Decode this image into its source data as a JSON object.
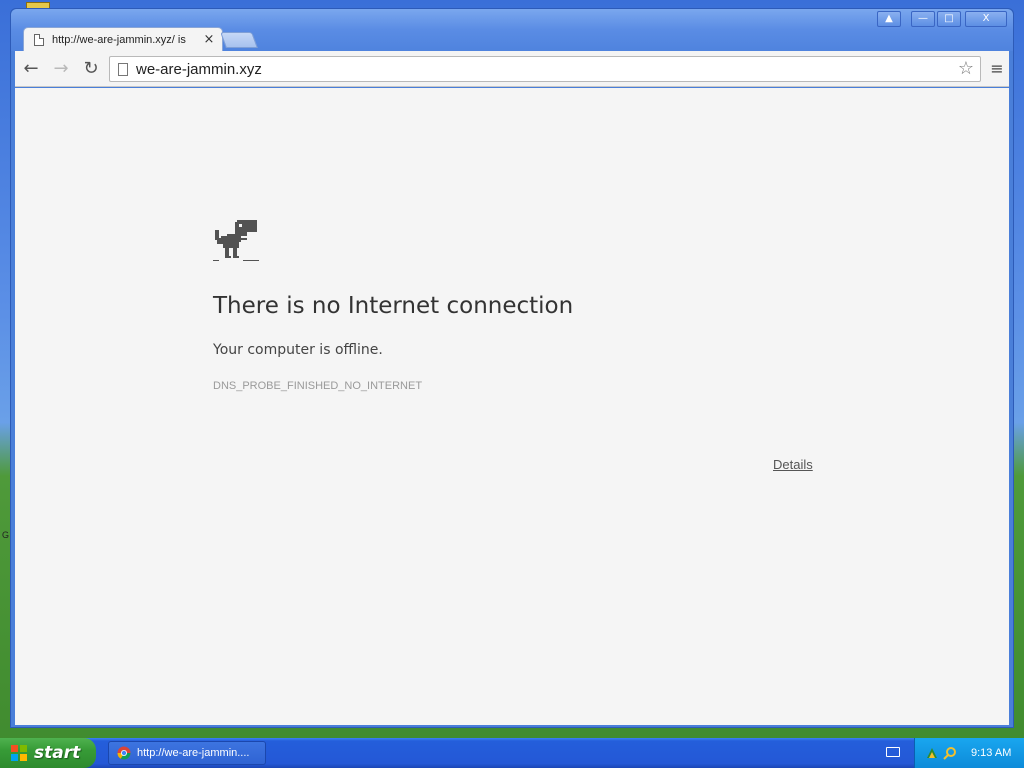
{
  "desktop": {
    "edge_letter": "G"
  },
  "browser": {
    "tab": {
      "title": "http://we-are-jammin.xyz/ is",
      "close_glyph": "×"
    },
    "window_controls": {
      "user": "▲",
      "minimize": "—",
      "maximize": "□",
      "close": "X"
    },
    "toolbar": {
      "back_glyph": "←",
      "forward_glyph": "→",
      "reload_glyph": "↻",
      "url": "we-are-jammin.xyz",
      "star_glyph": "☆",
      "menu_glyph": "≡"
    }
  },
  "error_page": {
    "heading": "There is no Internet connection",
    "subtext": "Your computer is offline.",
    "error_code": "DNS_PROBE_FINISHED_NO_INTERNET",
    "details_link": "Details"
  },
  "taskbar": {
    "start_label": "start",
    "task_item_label": "http://we-are-jammin....",
    "clock": "9:13 AM"
  },
  "colors": {
    "page_background": "#f5f5f5",
    "heading_text": "#333333",
    "error_code_text": "#9a9a9a",
    "taskbar_blue": "#245edb",
    "start_green": "#379b37",
    "tray_blue": "#0d8bd9"
  },
  "icons": [
    "page-icon",
    "star-icon",
    "menu-icon",
    "dino-icon",
    "windows-flag-icon",
    "chrome-icon",
    "keyboard-icon",
    "network-icon",
    "search-icon"
  ]
}
